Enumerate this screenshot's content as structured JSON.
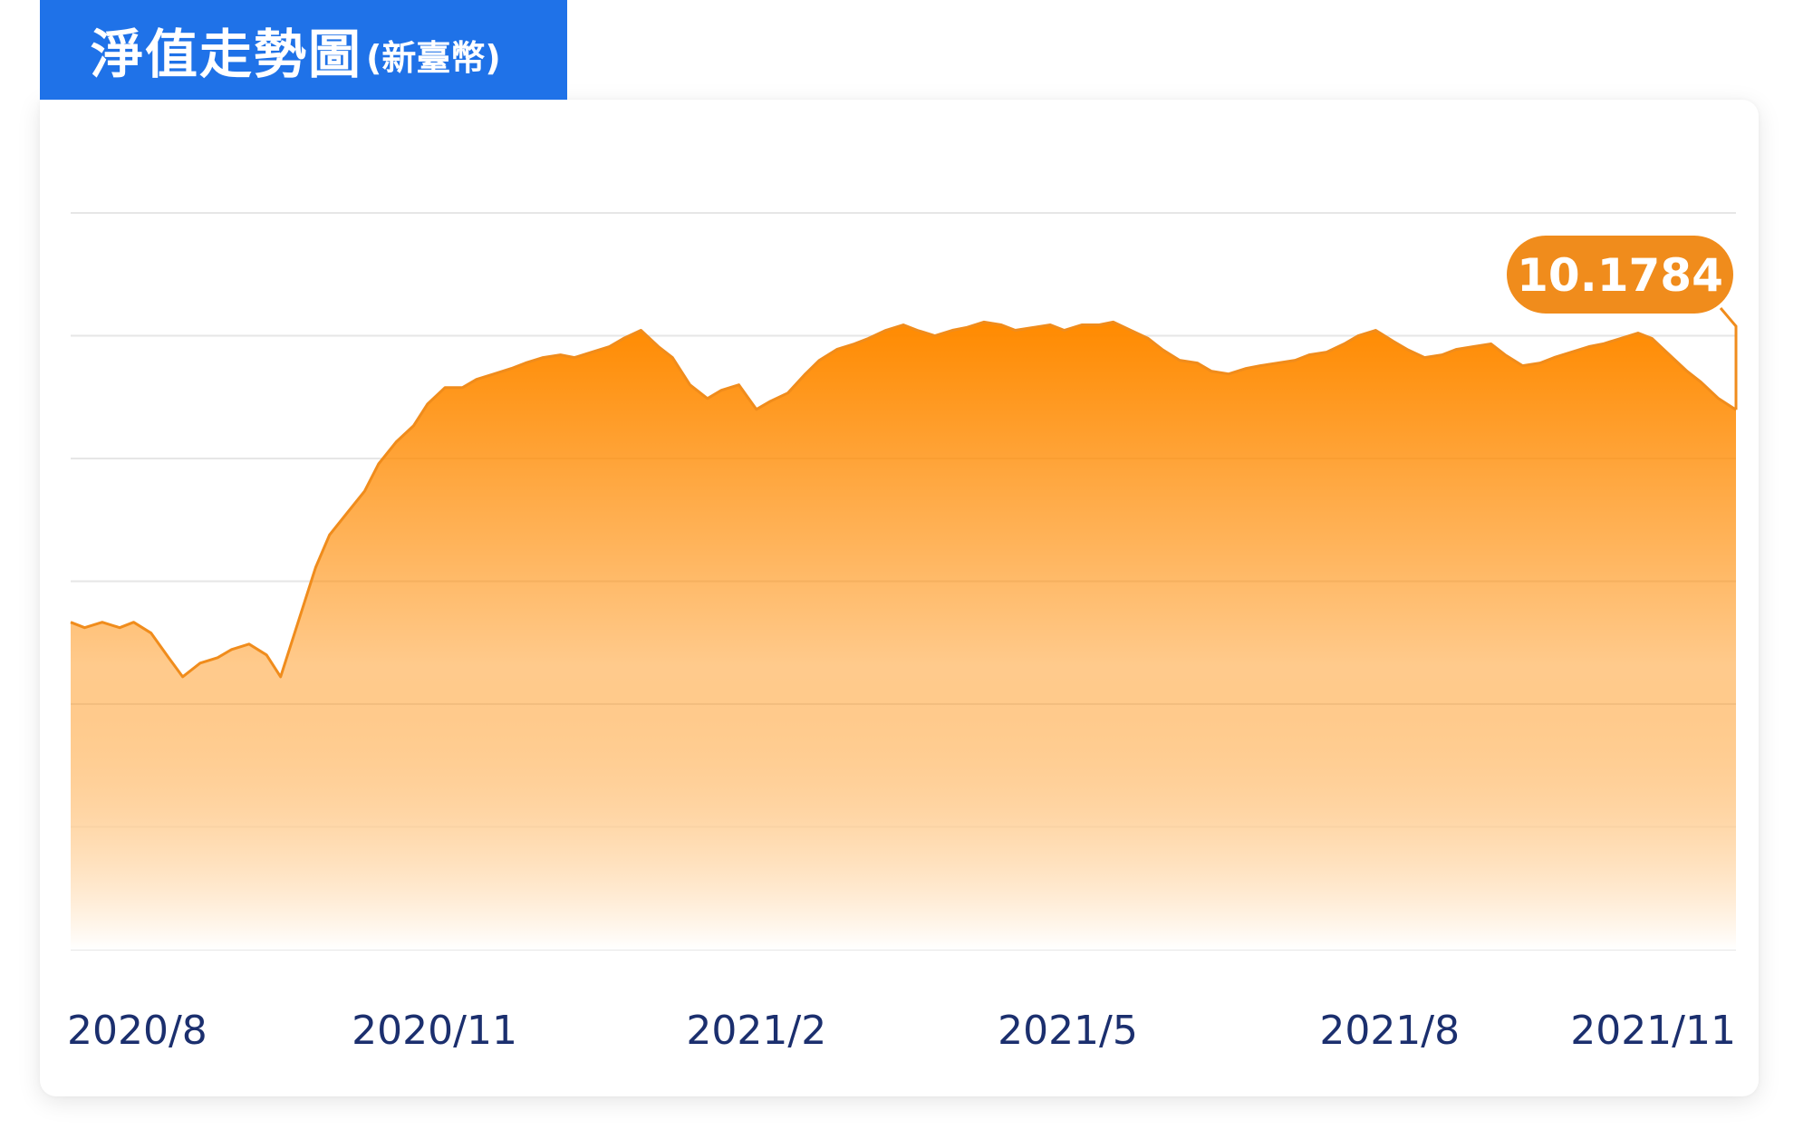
{
  "header": {
    "title": "淨值走勢圖",
    "subtitle": "(新臺幣)"
  },
  "colors": {
    "title_bg": "#1f72e8",
    "line": "#f08c1c",
    "fill_top": "#ff8a00",
    "fill_bottom": "#ffffff",
    "gridline": "#e6e6e6",
    "axis_label": "#1b2f6e",
    "badge_bg": "#f08c1c",
    "badge_text": "#ffffff"
  },
  "chart_data": {
    "type": "area",
    "title": "淨值走勢圖(新臺幣)",
    "xlabel": "",
    "ylabel": "",
    "tick_labels": [
      "2020/8",
      "2020/11",
      "2021/2",
      "2021/5",
      "2021/8",
      "2021/11"
    ],
    "grid": true,
    "y_axis_labels_shown": false,
    "last_value_label": "10.1784",
    "series": [
      {
        "name": "",
        "x": [
          "2020-08-03",
          "2020-08-07",
          "2020-08-12",
          "2020-08-17",
          "2020-08-21",
          "2020-08-26",
          "2020-08-31",
          "2020-09-04",
          "2020-09-09",
          "2020-09-14",
          "2020-09-18",
          "2020-09-23",
          "2020-09-28",
          "2020-10-02",
          "2020-10-07",
          "2020-10-12",
          "2020-10-16",
          "2020-10-21",
          "2020-10-26",
          "2020-10-30",
          "2020-11-04",
          "2020-11-09",
          "2020-11-13",
          "2020-11-18",
          "2020-11-23",
          "2020-11-27",
          "2020-12-02",
          "2020-12-07",
          "2020-12-11",
          "2020-12-16",
          "2020-12-21",
          "2020-12-25",
          "2020-12-30",
          "2021-01-04",
          "2021-01-08",
          "2021-01-13",
          "2021-01-18",
          "2021-01-22",
          "2021-01-27",
          "2021-02-01",
          "2021-02-05",
          "2021-02-10",
          "2021-02-15",
          "2021-02-19",
          "2021-02-24",
          "2021-03-01",
          "2021-03-05",
          "2021-03-10",
          "2021-03-15",
          "2021-03-19",
          "2021-03-24",
          "2021-03-29",
          "2021-04-02",
          "2021-04-07",
          "2021-04-12",
          "2021-04-16",
          "2021-04-21",
          "2021-04-26",
          "2021-04-30",
          "2021-05-05",
          "2021-05-10",
          "2021-05-14",
          "2021-05-19",
          "2021-05-24",
          "2021-05-28",
          "2021-06-02",
          "2021-06-07",
          "2021-06-11",
          "2021-06-16",
          "2021-06-21",
          "2021-06-25",
          "2021-06-30",
          "2021-07-05",
          "2021-07-09",
          "2021-07-14",
          "2021-07-19",
          "2021-07-23",
          "2021-07-28",
          "2021-08-02",
          "2021-08-06",
          "2021-08-11",
          "2021-08-16",
          "2021-08-20",
          "2021-08-25",
          "2021-08-30",
          "2021-09-03",
          "2021-09-08",
          "2021-09-13",
          "2021-09-17",
          "2021-09-22",
          "2021-09-27",
          "2021-10-01",
          "2021-10-06",
          "2021-10-11",
          "2021-10-15",
          "2021-10-20",
          "2021-10-25",
          "2021-10-29",
          "2021-11-03",
          "2021-11-08",
          "2021-11-12",
          "2021-11-17",
          "2021-11-22"
        ],
        "values": [
          9.4,
          9.38,
          9.4,
          9.38,
          9.4,
          9.36,
          9.27,
          9.2,
          9.25,
          9.27,
          9.3,
          9.32,
          9.28,
          9.2,
          9.4,
          9.6,
          9.72,
          9.8,
          9.88,
          9.98,
          10.06,
          10.12,
          10.2,
          10.26,
          10.26,
          10.29,
          10.31,
          10.33,
          10.35,
          10.37,
          10.38,
          10.37,
          10.39,
          10.41,
          10.44,
          10.47,
          10.41,
          10.37,
          10.27,
          10.22,
          10.25,
          10.27,
          10.18,
          10.21,
          10.24,
          10.31,
          10.36,
          10.4,
          10.42,
          10.44,
          10.47,
          10.49,
          10.47,
          10.45,
          10.47,
          10.48,
          10.5,
          10.49,
          10.47,
          10.48,
          10.49,
          10.47,
          10.49,
          10.49,
          10.5,
          10.47,
          10.44,
          10.4,
          10.36,
          10.35,
          10.32,
          10.31,
          10.33,
          10.34,
          10.35,
          10.36,
          10.38,
          10.39,
          10.42,
          10.45,
          10.47,
          10.43,
          10.4,
          10.37,
          10.38,
          10.4,
          10.41,
          10.42,
          10.38,
          10.34,
          10.35,
          10.37,
          10.39,
          10.41,
          10.42,
          10.44,
          10.46,
          10.44,
          10.38,
          10.32,
          10.28,
          10.22,
          10.1784
        ]
      }
    ]
  }
}
